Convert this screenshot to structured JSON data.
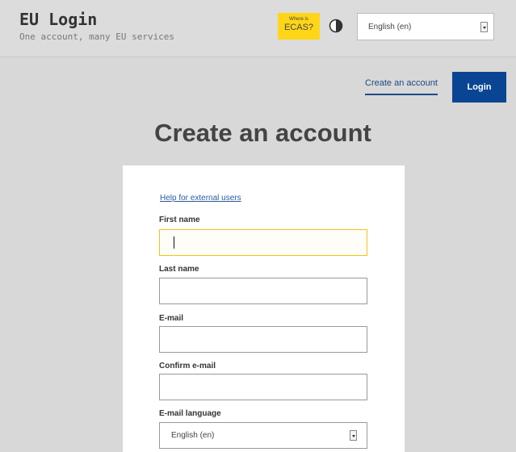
{
  "header": {
    "title": "EU Login",
    "subtitle": "One account, many EU services",
    "ecas_badge": {
      "line1": "Where is",
      "line2": "ECAS?",
      "color": "#ffd617"
    },
    "contrast_icon": "contrast-icon",
    "language_select": {
      "value": "English (en)",
      "icon": "chevron-down-icon"
    }
  },
  "nav": {
    "create_account": "Create an account",
    "login": "Login",
    "accent_color": "#0a4594"
  },
  "main": {
    "heading": "Create an account",
    "help_link": "Help for external users",
    "fields": {
      "first_name": {
        "label": "First name",
        "value": ""
      },
      "last_name": {
        "label": "Last name",
        "value": ""
      },
      "email": {
        "label": "E-mail",
        "value": ""
      },
      "confirm_email": {
        "label": "Confirm e-mail",
        "value": ""
      },
      "email_language": {
        "label": "E-mail language",
        "value": "English (en)"
      }
    },
    "focus_color": "#f0c419"
  }
}
